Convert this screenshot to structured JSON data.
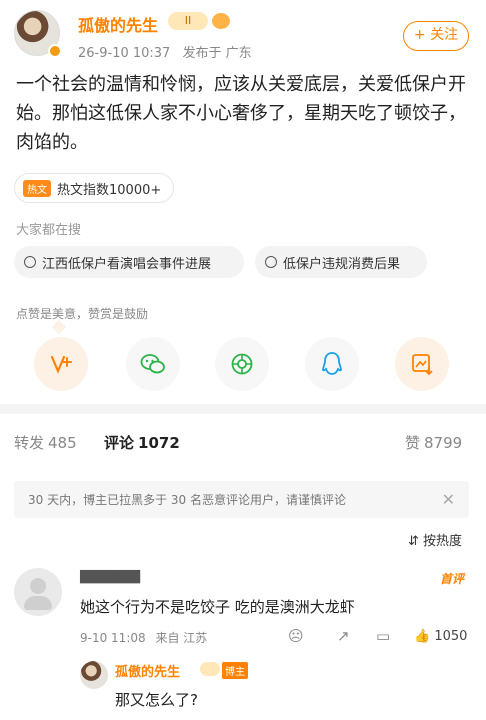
{
  "post": {
    "username": "孤傲的先生",
    "crown_badge": "II",
    "time": "26-9-10 10:37",
    "location": "发布于 广东",
    "follow_label": "+ 关注",
    "content": "一个社会的温情和怜悯，应该从关爱底层，关爱低保户开始。那怕这低保人家不小心奢侈了，星期天吃了顿饺子，肉馅的。",
    "hot_tag": "热文",
    "hot_index": "热文指数10000+"
  },
  "search": {
    "label": "大家都在搜",
    "chips": [
      "江西低保户看演唱会事件进展",
      "低保户违规消费后果"
    ]
  },
  "actions": {
    "hint": "点赞是美意，赞赏是鼓励",
    "icons": [
      "v-plus-icon",
      "wechat-icon",
      "moments-icon",
      "qq-icon",
      "save-image-icon"
    ]
  },
  "tabs": {
    "repost_label": "转发",
    "repost_count": "485",
    "comment_label": "评论",
    "comment_count": "1072",
    "like_label": "赞",
    "like_count": "8799"
  },
  "notice": "30 天内，博主已拉黑多于 30 名恶意评论用户，请谨慎评论",
  "sort_label": "按热度",
  "comment": {
    "badge": "首评",
    "text": "她这个行为不是吃饺子 吃的是澳洲大龙虾",
    "date": "9-10 11:08",
    "source": "来自 江苏",
    "likes": "1050"
  },
  "reply": {
    "name": "孤傲的先生",
    "author_tag": "博主",
    "text": "那又怎么了?"
  },
  "colors": {
    "accent": "#ff8200",
    "divider": "#f4f4f4"
  }
}
